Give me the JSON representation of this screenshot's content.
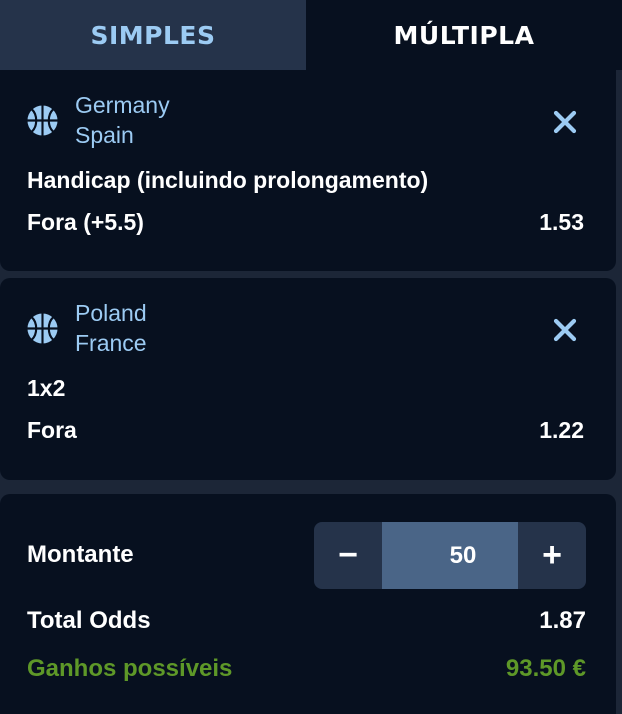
{
  "tabs": {
    "simples": "SIMPLES",
    "multipla": "MÚLTIPLA"
  },
  "bets": [
    {
      "home": "Germany",
      "away": "Spain",
      "market": "Handicap (incluindo prolongamento)",
      "selection": "Fora (+5.5)",
      "odd": "1.53",
      "sport_icon": "basketball-icon"
    },
    {
      "home": "Poland",
      "away": "France",
      "market": "1x2",
      "selection": "Fora",
      "odd": "1.22",
      "sport_icon": "basketball-icon"
    }
  ],
  "summary": {
    "stake_label": "Montante",
    "stake_value": "50",
    "decrement": "−",
    "increment": "+",
    "total_odds_label": "Total Odds",
    "total_odds_value": "1.87",
    "winnings_label": "Ganhos possíveis",
    "winnings_value": "93.50 €"
  },
  "colors": {
    "accent_blue": "#9ccbf3",
    "winnings_green": "#5e9828",
    "panel": "#07101f",
    "tab_inactive": "#25334a"
  }
}
